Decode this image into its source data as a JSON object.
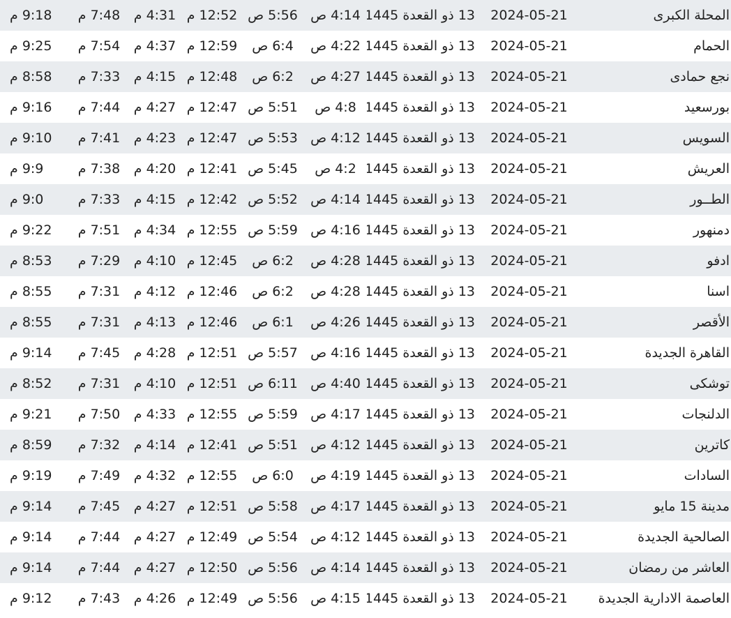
{
  "rows": [
    {
      "city": "المحلة الكبرى",
      "date": "2024-05-21",
      "hijri": "13 ذو القعدة 1445",
      "fajr": "4:14 ص",
      "sunrise": "5:56 ص",
      "dhuhr": "12:52 م",
      "asr": "4:31 م",
      "maghrib": "7:48 م",
      "isha": "9:18 م"
    },
    {
      "city": "الحمام",
      "date": "2024-05-21",
      "hijri": "13 ذو القعدة 1445",
      "fajr": "4:22 ص",
      "sunrise": "6:4 ص",
      "dhuhr": "12:59 م",
      "asr": "4:37 م",
      "maghrib": "7:54 م",
      "isha": "9:25 م"
    },
    {
      "city": "نجع حمادى",
      "date": "2024-05-21",
      "hijri": "13 ذو القعدة 1445",
      "fajr": "4:27 ص",
      "sunrise": "6:2 ص",
      "dhuhr": "12:48 م",
      "asr": "4:15 م",
      "maghrib": "7:33 م",
      "isha": "8:58 م"
    },
    {
      "city": "بورسعيد",
      "date": "2024-05-21",
      "hijri": "13 ذو القعدة 1445",
      "fajr": "4:8 ص",
      "sunrise": "5:51 ص",
      "dhuhr": "12:47 م",
      "asr": "4:27 م",
      "maghrib": "7:44 م",
      "isha": "9:16 م"
    },
    {
      "city": "السويس",
      "date": "2024-05-21",
      "hijri": "13 ذو القعدة 1445",
      "fajr": "4:12 ص",
      "sunrise": "5:53 ص",
      "dhuhr": "12:47 م",
      "asr": "4:23 م",
      "maghrib": "7:41 م",
      "isha": "9:10 م"
    },
    {
      "city": "العريش",
      "date": "2024-05-21",
      "hijri": "13 ذو القعدة 1445",
      "fajr": "4:2 ص",
      "sunrise": "5:45 ص",
      "dhuhr": "12:41 م",
      "asr": "4:20 م",
      "maghrib": "7:38 م",
      "isha": "9:9 م"
    },
    {
      "city": "الطــور",
      "date": "2024-05-21",
      "hijri": "13 ذو القعدة 1445",
      "fajr": "4:14 ص",
      "sunrise": "5:52 ص",
      "dhuhr": "12:42 م",
      "asr": "4:15 م",
      "maghrib": "7:33 م",
      "isha": "9:0 م"
    },
    {
      "city": "دمنهور",
      "date": "2024-05-21",
      "hijri": "13 ذو القعدة 1445",
      "fajr": "4:16 ص",
      "sunrise": "5:59 ص",
      "dhuhr": "12:55 م",
      "asr": "4:34 م",
      "maghrib": "7:51 م",
      "isha": "9:22 م"
    },
    {
      "city": "ادفو",
      "date": "2024-05-21",
      "hijri": "13 ذو القعدة 1445",
      "fajr": "4:28 ص",
      "sunrise": "6:2 ص",
      "dhuhr": "12:45 م",
      "asr": "4:10 م",
      "maghrib": "7:29 م",
      "isha": "8:53 م"
    },
    {
      "city": "اسنا",
      "date": "2024-05-21",
      "hijri": "13 ذو القعدة 1445",
      "fajr": "4:28 ص",
      "sunrise": "6:2 ص",
      "dhuhr": "12:46 م",
      "asr": "4:12 م",
      "maghrib": "7:31 م",
      "isha": "8:55 م"
    },
    {
      "city": "الأقصر",
      "date": "2024-05-21",
      "hijri": "13 ذو القعدة 1445",
      "fajr": "4:26 ص",
      "sunrise": "6:1 ص",
      "dhuhr": "12:46 م",
      "asr": "4:13 م",
      "maghrib": "7:31 م",
      "isha": "8:55 م"
    },
    {
      "city": "القاهرة الجديدة",
      "date": "2024-05-21",
      "hijri": "13 ذو القعدة 1445",
      "fajr": "4:16 ص",
      "sunrise": "5:57 ص",
      "dhuhr": "12:51 م",
      "asr": "4:28 م",
      "maghrib": "7:45 م",
      "isha": "9:14 م"
    },
    {
      "city": "توشكى",
      "date": "2024-05-21",
      "hijri": "13 ذو القعدة 1445",
      "fajr": "4:40 ص",
      "sunrise": "6:11 ص",
      "dhuhr": "12:51 م",
      "asr": "4:10 م",
      "maghrib": "7:31 م",
      "isha": "8:52 م"
    },
    {
      "city": "الدلنجات",
      "date": "2024-05-21",
      "hijri": "13 ذو القعدة 1445",
      "fajr": "4:17 ص",
      "sunrise": "5:59 ص",
      "dhuhr": "12:55 م",
      "asr": "4:33 م",
      "maghrib": "7:50 م",
      "isha": "9:21 م"
    },
    {
      "city": "كاترين",
      "date": "2024-05-21",
      "hijri": "13 ذو القعدة 1445",
      "fajr": "4:12 ص",
      "sunrise": "5:51 ص",
      "dhuhr": "12:41 م",
      "asr": "4:14 م",
      "maghrib": "7:32 م",
      "isha": "8:59 م"
    },
    {
      "city": "السادات",
      "date": "2024-05-21",
      "hijri": "13 ذو القعدة 1445",
      "fajr": "4:19 ص",
      "sunrise": "6:0 ص",
      "dhuhr": "12:55 م",
      "asr": "4:32 م",
      "maghrib": "7:49 م",
      "isha": "9:19 م"
    },
    {
      "city": "مدينة 15 مايو",
      "date": "2024-05-21",
      "hijri": "13 ذو القعدة 1445",
      "fajr": "4:17 ص",
      "sunrise": "5:58 ص",
      "dhuhr": "12:51 م",
      "asr": "4:27 م",
      "maghrib": "7:45 م",
      "isha": "9:14 م"
    },
    {
      "city": "الصالحية الجديدة",
      "date": "2024-05-21",
      "hijri": "13 ذو القعدة 1445",
      "fajr": "4:12 ص",
      "sunrise": "5:54 ص",
      "dhuhr": "12:49 م",
      "asr": "4:27 م",
      "maghrib": "7:44 م",
      "isha": "9:14 م"
    },
    {
      "city": "العاشر من رمضان",
      "date": "2024-05-21",
      "hijri": "13 ذو القعدة 1445",
      "fajr": "4:14 ص",
      "sunrise": "5:56 ص",
      "dhuhr": "12:50 م",
      "asr": "4:27 م",
      "maghrib": "7:44 م",
      "isha": "9:14 م"
    },
    {
      "city": "العاصمة الادارية الجديدة",
      "date": "2024-05-21",
      "hijri": "13 ذو القعدة 1445",
      "fajr": "4:15 ص",
      "sunrise": "5:56 ص",
      "dhuhr": "12:49 م",
      "asr": "4:26 م",
      "maghrib": "7:43 م",
      "isha": "9:12 م"
    }
  ],
  "colors": {
    "row_alt": "#e9ecef",
    "row_plain": "#ffffff",
    "text": "#222222"
  }
}
